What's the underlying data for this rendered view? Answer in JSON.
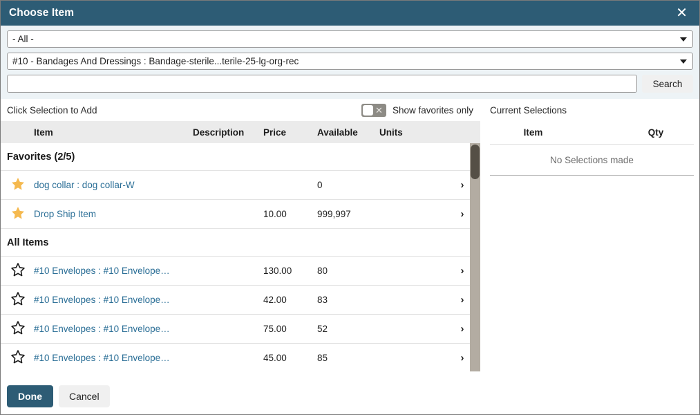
{
  "dialog": {
    "title": "Choose Item",
    "close_label": "✕"
  },
  "filters": {
    "category_select": "- All -",
    "item_select": "#10 - Bandages And Dressings : Bandage-sterile...terile-25-lg-org-rec",
    "search_value": "",
    "search_placeholder": "",
    "search_button": "Search"
  },
  "left": {
    "instruction": "Click Selection to Add",
    "favorites_toggle_label": "Show favorites only",
    "favorites_toggle_state": "off",
    "columns": {
      "item": "Item",
      "description": "Description",
      "price": "Price",
      "available": "Available",
      "units": "Units"
    },
    "groups": [
      {
        "heading": "Favorites (2/5)",
        "rows": [
          {
            "favorite": true,
            "item": "dog collar : dog collar-W",
            "description": "",
            "price": "",
            "available": "0",
            "units": ""
          },
          {
            "favorite": true,
            "item": "Drop Ship Item",
            "description": "",
            "price": "10.00",
            "available": "999,997",
            "units": ""
          }
        ]
      },
      {
        "heading": "All Items",
        "rows": [
          {
            "favorite": false,
            "item": "#10 Envelopes : #10 Envelope…",
            "description": "",
            "price": "130.00",
            "available": "80",
            "units": ""
          },
          {
            "favorite": false,
            "item": "#10 Envelopes : #10 Envelope…",
            "description": "",
            "price": "42.00",
            "available": "83",
            "units": ""
          },
          {
            "favorite": false,
            "item": "#10 Envelopes : #10 Envelope…",
            "description": "",
            "price": "75.00",
            "available": "52",
            "units": ""
          },
          {
            "favorite": false,
            "item": "#10 Envelopes : #10 Envelope…",
            "description": "",
            "price": "45.00",
            "available": "85",
            "units": ""
          }
        ]
      }
    ]
  },
  "right": {
    "title": "Current Selections",
    "columns": {
      "item": "Item",
      "qty": "Qty"
    },
    "empty_message": "No Selections made"
  },
  "footer": {
    "done_label": "Done",
    "cancel_label": "Cancel"
  },
  "colors": {
    "header_bg": "#2d5c75",
    "filter_bg": "#edf3f6",
    "link": "#2a6e96",
    "star_filled": "#f5b94f",
    "scroll_track": "#b3aca2",
    "scroll_thumb": "#554f46",
    "table_header_bg": "#ebebeb"
  }
}
